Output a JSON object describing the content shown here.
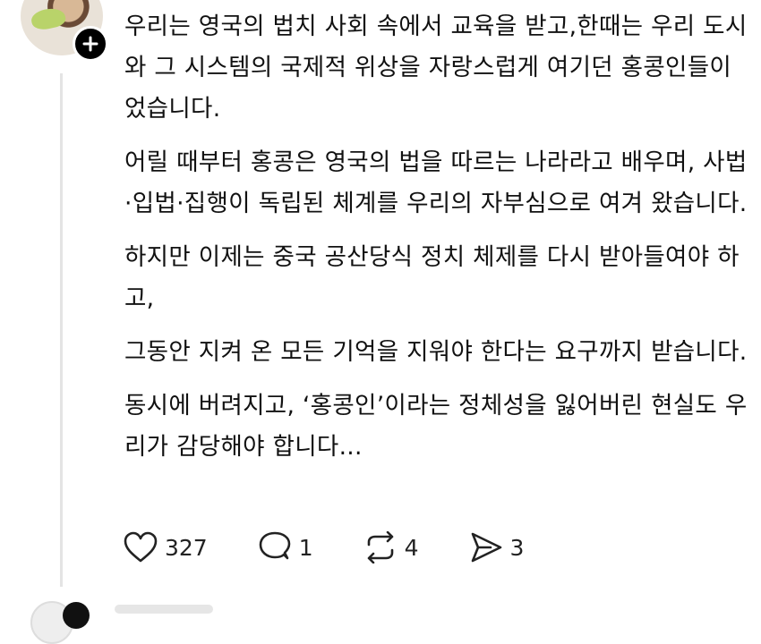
{
  "post": {
    "paragraphs": [
      "우리는 영국의 법치 사회 속에서 교육을 받고,한때는 우리 도시와 그 시스템의 국제적 위상을 자랑스럽게 여기던 홍콩인들이었습니다.",
      "어릴 때부터 홍콩은 영국의 법을 따르는 나라라고 배우며, 사법·입법·집행이 독립된 체계를 우리의 자부심으로 여겨 왔습니다.",
      "하지만 이제는 중국 공산당식 정치 체제를 다시 받아들여야 하고,",
      "그동안 지켜 온 모든 기억을 지워야 한다는 요구까지 받습니다.",
      "동시에 버려지고, ‘홍콩인’이라는 정체성을 잃어버린 현실도 우리가 감당해야 합니다..."
    ]
  },
  "actions": {
    "likes": "327",
    "replies": "1",
    "reposts": "4",
    "shares": "3"
  },
  "icons": {
    "follow": "plus-icon",
    "like": "heart-icon",
    "reply": "comment-icon",
    "repost": "repost-icon",
    "share": "send-icon"
  },
  "colors": {
    "text": "#111111",
    "thread_line": "#e4e4e4",
    "follow_button": "#000000"
  }
}
